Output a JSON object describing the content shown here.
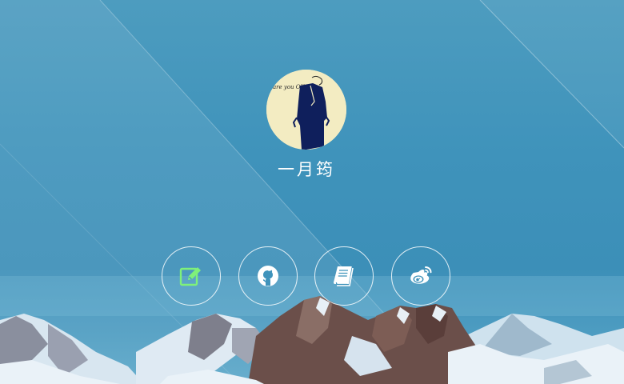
{
  "profile": {
    "name": "一月筠",
    "avatar_text": "are you OK?"
  },
  "links": [
    {
      "id": "blog",
      "icon": "edit-icon",
      "color": "#7ff07a"
    },
    {
      "id": "github",
      "icon": "github-icon",
      "color": "#ffffff"
    },
    {
      "id": "notes",
      "icon": "book-icon",
      "color": "#ffffff"
    },
    {
      "id": "weibo",
      "icon": "weibo-icon",
      "color": "#ffffff"
    }
  ],
  "colors": {
    "sky": "#3f93bb",
    "accent_green": "#7ff07a",
    "avatar_bg": "#f3ecc2",
    "figure": "#0f1f5c"
  }
}
